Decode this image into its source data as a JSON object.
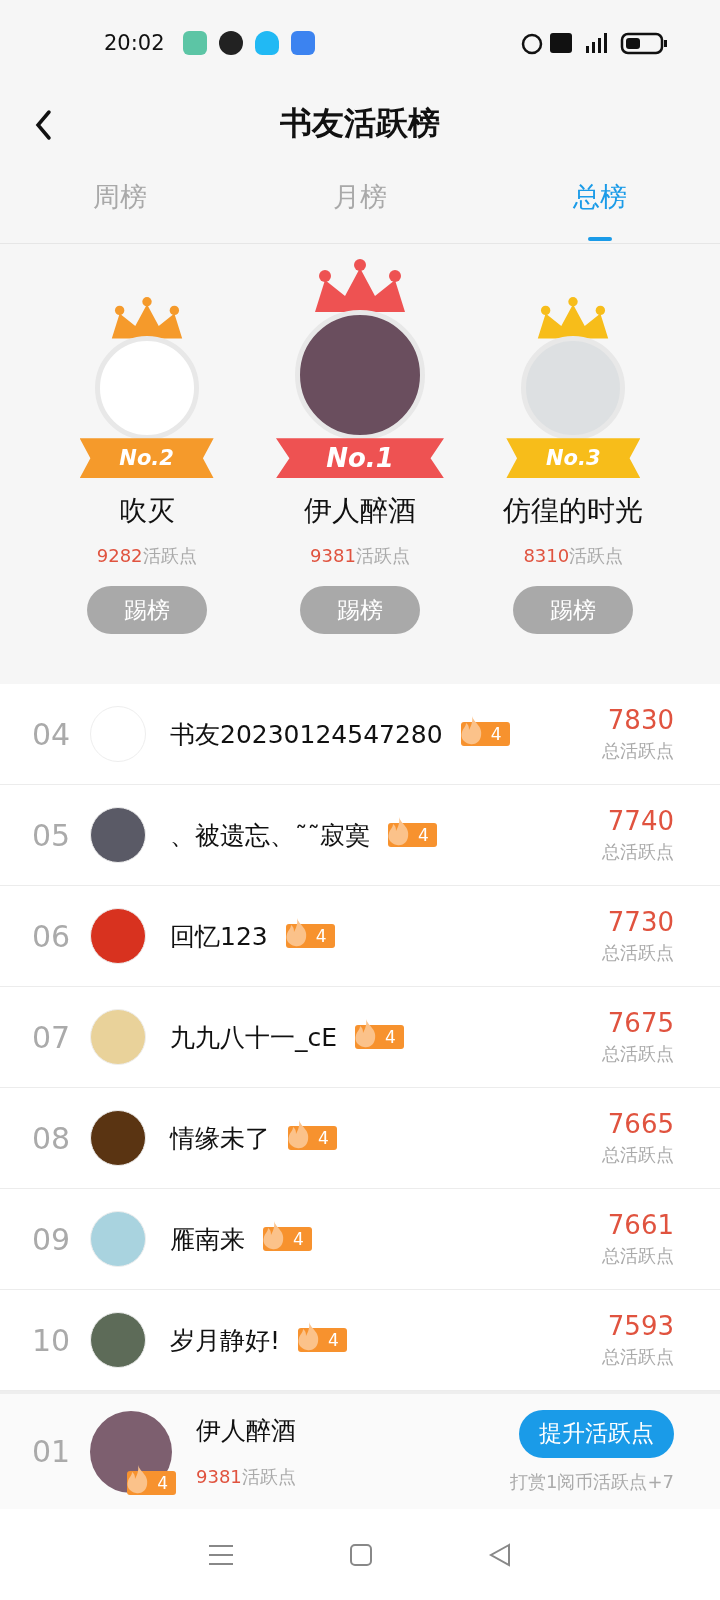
{
  "status_bar": {
    "time": "20:02"
  },
  "header": {
    "title": "书友活跃榜"
  },
  "tabs": [
    {
      "label": "周榜",
      "selected": false
    },
    {
      "label": "月榜",
      "selected": false
    },
    {
      "label": "总榜",
      "selected": true
    }
  ],
  "podium": [
    {
      "rank": "No.2",
      "name": "吹灭",
      "points": "9282",
      "points_label": "活跃点",
      "button": "踢榜",
      "color": "#f59a2b",
      "first": false
    },
    {
      "rank": "No.1",
      "name": "伊人醉酒",
      "points": "9381",
      "points_label": "活跃点",
      "button": "踢榜",
      "color": "#ee5252",
      "first": true
    },
    {
      "rank": "No.3",
      "name": "仿徨的时光",
      "points": "8310",
      "points_label": "活跃点",
      "button": "踢榜",
      "color": "#f7bd1a",
      "first": false
    }
  ],
  "ranking": [
    {
      "rank": "04",
      "name": "书友20230124547280",
      "level": "4",
      "score": "7830",
      "score_label": "总活跃点"
    },
    {
      "rank": "05",
      "name": "、被遗忘、˜˜寂寞",
      "level": "4",
      "score": "7740",
      "score_label": "总活跃点"
    },
    {
      "rank": "06",
      "name": "回忆123",
      "level": "4",
      "score": "7730",
      "score_label": "总活跃点"
    },
    {
      "rank": "07",
      "name": "九九八十一_cE",
      "level": "4",
      "score": "7675",
      "score_label": "总活跃点"
    },
    {
      "rank": "08",
      "name": "情缘未了",
      "level": "4",
      "score": "7665",
      "score_label": "总活跃点"
    },
    {
      "rank": "09",
      "name": "雁南来",
      "level": "4",
      "score": "7661",
      "score_label": "总活跃点"
    },
    {
      "rank": "10",
      "name": "岁月静好!",
      "level": "4",
      "score": "7593",
      "score_label": "总活跃点"
    }
  ],
  "my_rank": {
    "rank": "01",
    "name": "伊人醉酒",
    "level": "4",
    "points": "9381",
    "points_label": "活跃点",
    "button": "提升活跃点",
    "hint": "打赏1阅币活跃点+7"
  }
}
